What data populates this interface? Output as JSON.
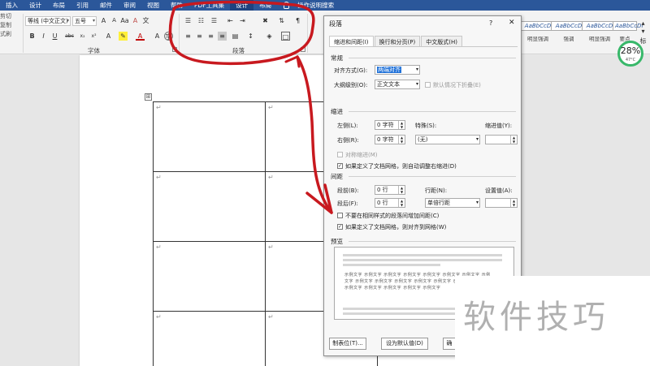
{
  "menubar": {
    "tabs": [
      "插入",
      "设计",
      "布局",
      "引用",
      "邮件",
      "审阅",
      "视图",
      "帮助",
      "PDF工具集",
      "设计",
      "布局"
    ],
    "search_label": "操作说明搜索"
  },
  "ribbon": {
    "left_cut": [
      "剪切",
      "复制",
      "式刷"
    ],
    "font_name": "等线 (中文正文)",
    "font_size": "五号",
    "font_group_label": "字体",
    "paragraph_group_label": "段落",
    "styles": [
      {
        "preview": "AaBbCcDı",
        "name": "明显强调"
      },
      {
        "preview": "AaBbCcDı",
        "name": "强调"
      },
      {
        "preview": "AaBbCcDı",
        "name": "明显强调"
      },
      {
        "preview": "AaBbCcDı",
        "name": "要点"
      }
    ],
    "more_styles": "标"
  },
  "badge": {
    "percent": "28%",
    "temp": "47°C"
  },
  "document": {
    "paragraph_mark": "↵",
    "move_handle": "⊞"
  },
  "dialog": {
    "title": "段落",
    "help": "?",
    "close": "✕",
    "tabs": [
      "缩进和间距(I)",
      "换行和分页(P)",
      "中文版式(H)"
    ],
    "general": {
      "heading": "常规",
      "alignment_label": "对齐方式(G):",
      "alignment_value": "两端对齐",
      "outline_label": "大纲级别(O):",
      "outline_value": "正文文本",
      "collapsed_label": "默认情况下折叠(E)"
    },
    "indent": {
      "heading": "缩进",
      "left_label": "左侧(L):",
      "left_value": "0 字符",
      "right_label": "右侧(R):",
      "right_value": "0 字符",
      "special_label": "特殊(S):",
      "special_value": "(无)",
      "by_label": "缩进值(Y):",
      "mirror_label": "对称缩进(M)",
      "auto_adjust_label": "如果定义了文档网格，则自动调整右缩进(D)"
    },
    "spacing": {
      "heading": "间距",
      "before_label": "段前(B):",
      "before_value": "0 行",
      "after_label": "段后(F):",
      "after_value": "0 行",
      "line_label": "行距(N):",
      "line_value": "单倍行距",
      "at_label": "设置值(A):",
      "no_space_label": "不要在相同样式的段落间增加间距(C)",
      "snap_grid_label": "如果定义了文档网格，则对齐到网格(W)"
    },
    "preview": {
      "heading": "预览",
      "sample": "示例文字 示例文字 示例文字 示例文字 示例文字 示例文字 示例文字 示例文字 示例文字 示例文字 示例文字 示例文字 示例文字 示例文字 示例文字 示例文字 示例文字 示例文字 示例文字 示例文字"
    },
    "buttons": {
      "tabs": "制表位(T)...",
      "default": "设为默认值(D)",
      "ok": "确"
    }
  },
  "watermark": "软件技巧",
  "colors": {
    "ribbon_blue": "#2b579a",
    "annotation_red": "#c8191f",
    "badge_green": "#38b86a"
  }
}
